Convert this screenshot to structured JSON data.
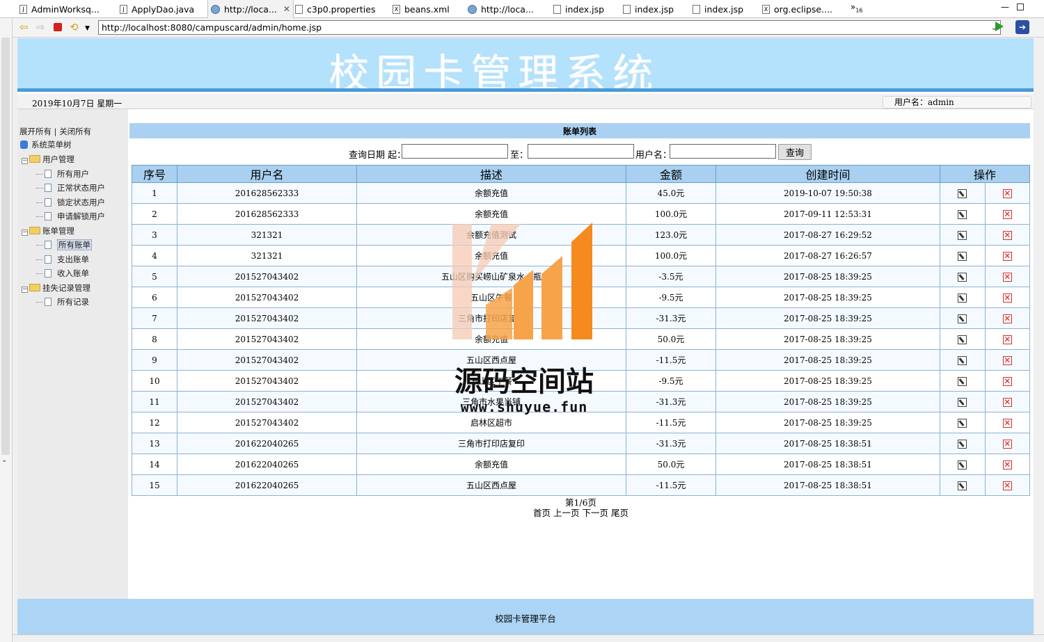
{
  "ide_tabs": [
    {
      "label": "AdminWorksq...",
      "icon": "java-file-icon"
    },
    {
      "label": "ApplyDao.java",
      "icon": "java-file-icon"
    },
    {
      "label": "http://loca...",
      "icon": "globe-icon",
      "active": true,
      "close": "✕"
    },
    {
      "label": "c3p0.properties",
      "icon": "properties-file-icon"
    },
    {
      "label": "beans.xml",
      "icon": "xml-file-icon"
    },
    {
      "label": "http://loca...",
      "icon": "globe-icon"
    },
    {
      "label": "index.jsp",
      "icon": "jsp-file-icon"
    },
    {
      "label": "index.jsp",
      "icon": "jsp-file-icon"
    },
    {
      "label": "index.jsp",
      "icon": "jsp-file-icon"
    },
    {
      "label": "org.eclipse....",
      "icon": "xml-file-icon"
    }
  ],
  "tab_overflow": {
    "symbol": "»",
    "count": "16"
  },
  "browser": {
    "url": "http://localhost:8080/campuscard/admin/home.jsp"
  },
  "header": {
    "title": "校园卡管理系统",
    "date": "2019年10月7日 星期一",
    "user_label": "用户名：admin"
  },
  "sidebar": {
    "expand_all": "展开所有",
    "separator": "|",
    "collapse_all": "关闭所有",
    "root": "系统菜单树",
    "groups": [
      {
        "label": "用户管理",
        "items": [
          "所有用户",
          "正常状态用户",
          "锁定状态用户",
          "申请解锁用户"
        ]
      },
      {
        "label": "账单管理",
        "items": [
          "所有账单",
          "支出账单",
          "收入账单"
        ]
      },
      {
        "label": "挂失记录管理",
        "items": [
          "所有记录"
        ]
      }
    ],
    "selected": "所有账单"
  },
  "list": {
    "title": "账单列表",
    "query_date_from_label": "查询日期 起：",
    "query_date_to_label": "至：",
    "query_user_label": "用户名：",
    "query_button": "查询",
    "columns": [
      "序号",
      "用户名",
      "描述",
      "金额",
      "创建时间",
      "操作"
    ],
    "rows": [
      {
        "no": "1",
        "user": "201628562333",
        "desc": "余额充值",
        "amount": "45.0元",
        "time": "2019-10-07 19:50:38"
      },
      {
        "no": "2",
        "user": "201628562333",
        "desc": "余额充值",
        "amount": "100.0元",
        "time": "2017-09-11 12:53:31"
      },
      {
        "no": "3",
        "user": "321321",
        "desc": "余额充值测试",
        "amount": "123.0元",
        "time": "2017-08-27 16:29:52"
      },
      {
        "no": "4",
        "user": "321321",
        "desc": "余额充值",
        "amount": "100.0元",
        "time": "2017-08-27 16:26:57"
      },
      {
        "no": "5",
        "user": "201527043402",
        "desc": "五山区购买崂山矿泉水一瓶",
        "amount": "-3.5元",
        "time": "2017-08-25 18:39:25"
      },
      {
        "no": "6",
        "user": "201527043402",
        "desc": "五山区午餐",
        "amount": "-9.5元",
        "time": "2017-08-25 18:39:25"
      },
      {
        "no": "7",
        "user": "201527043402",
        "desc": "三角市打印店复印",
        "amount": "-31.3元",
        "time": "2017-08-25 18:39:25"
      },
      {
        "no": "8",
        "user": "201527043402",
        "desc": "余额充值",
        "amount": "50.0元",
        "time": "2017-08-25 18:39:25"
      },
      {
        "no": "9",
        "user": "201527043402",
        "desc": "五山区西点屋",
        "amount": "-11.5元",
        "time": "2017-08-25 18:39:25"
      },
      {
        "no": "10",
        "user": "201527043402",
        "desc": "五山区午餐",
        "amount": "-9.5元",
        "time": "2017-08-25 18:39:25"
      },
      {
        "no": "11",
        "user": "201527043402",
        "desc": "三角市水果当铺",
        "amount": "-31.3元",
        "time": "2017-08-25 18:39:25"
      },
      {
        "no": "12",
        "user": "201527043402",
        "desc": "启林区超市",
        "amount": "-11.5元",
        "time": "2017-08-25 18:39:25"
      },
      {
        "no": "13",
        "user": "201622040265",
        "desc": "三角市打印店复印",
        "amount": "-31.3元",
        "time": "2017-08-25 18:38:51"
      },
      {
        "no": "14",
        "user": "201622040265",
        "desc": "余额充值",
        "amount": "50.0元",
        "time": "2017-08-25 18:38:51"
      },
      {
        "no": "15",
        "user": "201622040265",
        "desc": "五山区西点屋",
        "amount": "-11.5元",
        "time": "2017-08-25 18:38:51"
      }
    ],
    "pager": {
      "page_info": "第1/6页",
      "first": "首页",
      "prev": "上一页",
      "next": "下一页",
      "last": "尾页"
    }
  },
  "footer": {
    "text": "校园卡管理平台"
  },
  "watermark": {
    "text": "源码空间站",
    "url": "www.shuyue.fun",
    "colors": [
      "#f6c9b3",
      "#f7a34a",
      "#f58a1f"
    ]
  }
}
